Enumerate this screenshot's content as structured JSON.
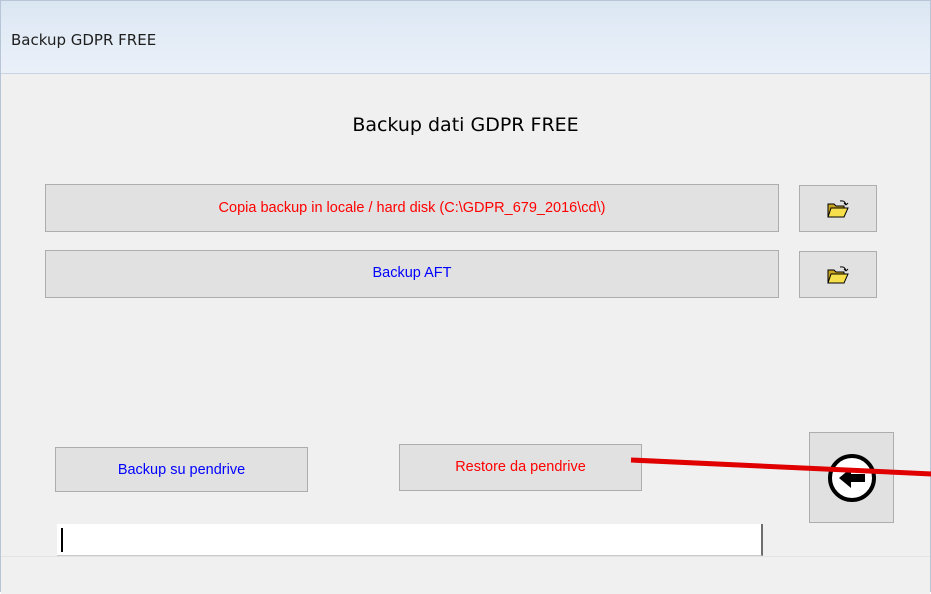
{
  "window": {
    "title": "Backup GDPR FREE"
  },
  "main": {
    "heading": "Backup dati GDPR FREE",
    "buttons": {
      "copy_local": "Copia backup in locale / hard disk (C:\\GDPR_679_2016\\cd\\)",
      "backup_aft": "Backup AFT",
      "backup_pendrive": "Backup su pendrive",
      "restore_pendrive": "Restore da pendrive"
    },
    "icons": {
      "folder_button_1": "open-folder-icon",
      "folder_button_2": "open-folder-icon",
      "back_button": "back-arrow-circle-icon"
    },
    "progress_value": ""
  },
  "annotation": {
    "arrow_color": "#e00000"
  },
  "colors": {
    "red_text": "#ff0000",
    "blue_text": "#0000ff",
    "button_face": "#e1e1e1"
  }
}
